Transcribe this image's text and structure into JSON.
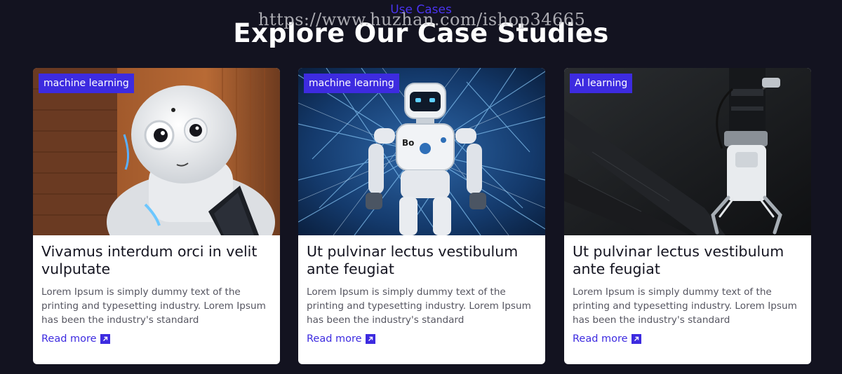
{
  "header": {
    "eyebrow": "Use Cases",
    "title": "Explore Our Case Studies",
    "watermark": "https://www.huzhan.com/ishop34665"
  },
  "theme": {
    "background": "#131320",
    "accent": "#3d2be0",
    "card": "#ffffff"
  },
  "cards": [
    {
      "tag": "machine learning",
      "title": "Vivamus interdum orci in velit vulputate",
      "text": "Lorem Ipsum is simply dummy text of the printing and typesetting industry. Lorem Ipsum has been the industry's standard",
      "link": "Read more",
      "image": "humanoid-robot-photo",
      "link_icon": "arrow-up-right-icon"
    },
    {
      "tag": "machine learning",
      "title": "Ut pulvinar lectus vestibulum ante feugiat",
      "text": "Lorem Ipsum is simply dummy text of the printing and typesetting industry. Lorem Ipsum has been the industry's standard",
      "link": "Read more",
      "image": "toy-robot-network-photo",
      "link_icon": "arrow-up-right-icon"
    },
    {
      "tag": "AI learning",
      "title": "Ut pulvinar lectus vestibulum ante feugiat",
      "text": "Lorem Ipsum is simply dummy text of the printing and typesetting industry. Lorem Ipsum has been the industry's standard",
      "link": "Read more",
      "image": "robotic-arm-gripper-photo",
      "link_icon": "arrow-up-right-icon"
    }
  ]
}
